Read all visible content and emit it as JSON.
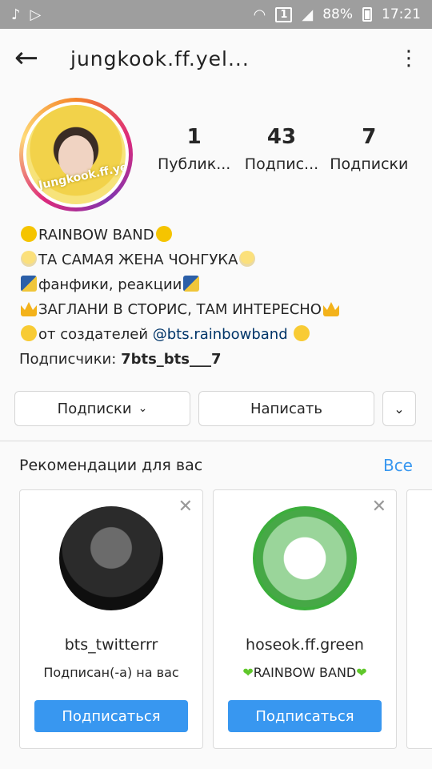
{
  "statusbar": {
    "left_icons": [
      "music-note-icon",
      "play-store-icon"
    ],
    "sim_label": "1",
    "battery": "88%",
    "time": "17:21"
  },
  "header": {
    "username": "jungkook.ff.yel..."
  },
  "profile": {
    "avatar_text": "Jungkook.ff.yellow",
    "stats": [
      {
        "value": "1",
        "label": "Публик..."
      },
      {
        "value": "43",
        "label": "Подпис..."
      },
      {
        "value": "7",
        "label": "Подписки"
      }
    ]
  },
  "bio": {
    "line1": "RAINBOW BAND",
    "line2": "ТА САМАЯ ЖЕНА ЧОНГУКА",
    "line3": "фанфики, реакции",
    "line4": "ЗАГЛАНИ В СТОРИС, ТАМ ИНТЕРЕСНО",
    "line5_prefix": "от создателей",
    "line5_link": "@bts.rainbowband",
    "line6_label": "Подписчики:",
    "line6_value": "7bts_bts___7"
  },
  "actions": {
    "following_label": "Подписки",
    "message_label": "Написать"
  },
  "recommendations": {
    "title": "Рекомендации для вас",
    "see_all": "Все",
    "cards": [
      {
        "name": "bts_twitterrr",
        "subtitle": "Подписан(-а) на вас",
        "button": "Подписаться"
      },
      {
        "name": "hoseok.ff.green",
        "subtitle": "RAINBOW BAND",
        "button": "Подписаться"
      }
    ]
  },
  "colors": {
    "accent": "#3897f0",
    "statusbar": "#9e9e9e"
  }
}
